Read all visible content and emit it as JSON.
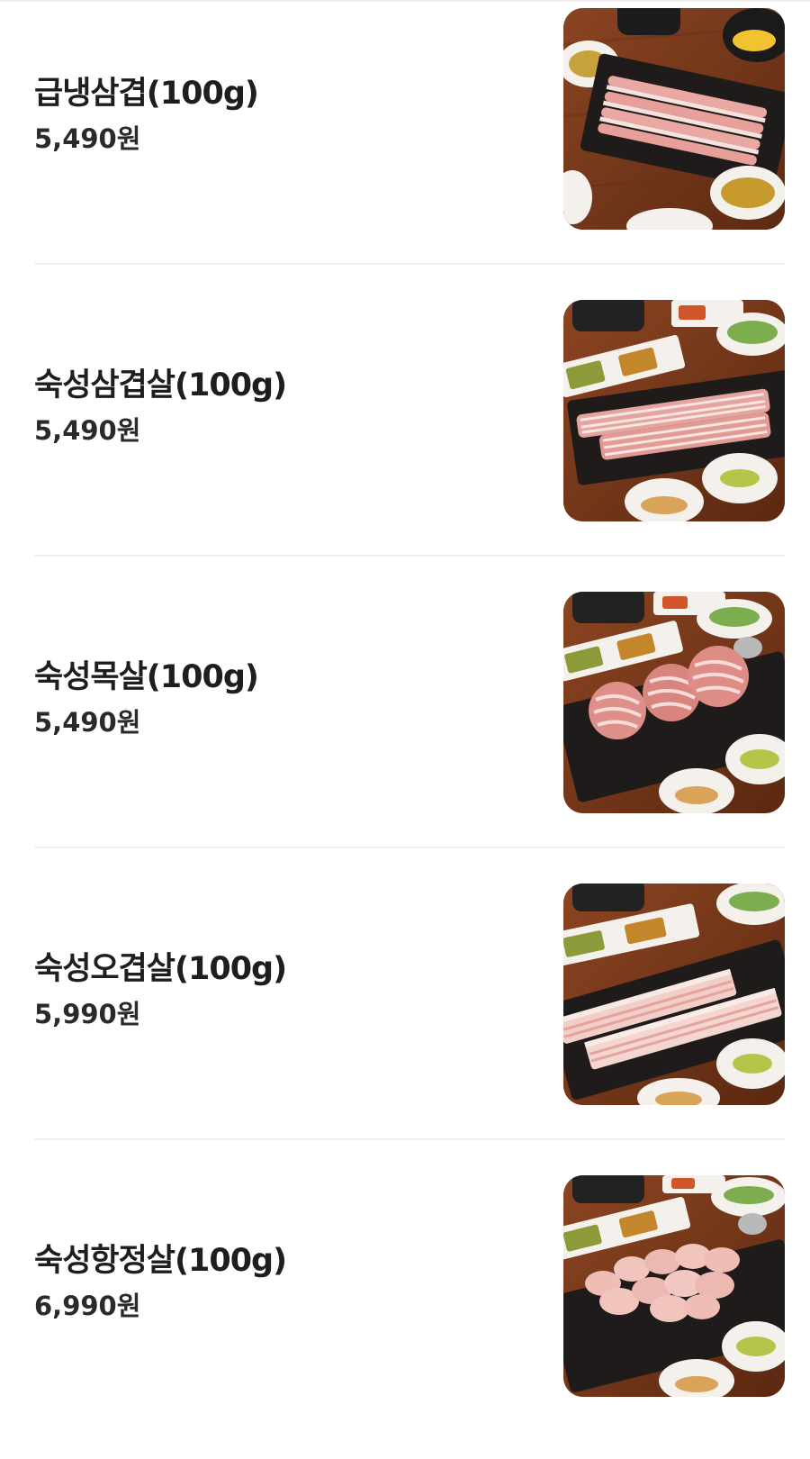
{
  "menu": {
    "items": [
      {
        "name": "급냉삼겹(100g)",
        "price": "5,490원",
        "image_icon": "frozen-pork-belly-photo"
      },
      {
        "name": "숙성삼겹살(100g)",
        "price": "5,490원",
        "image_icon": "aged-pork-belly-photo"
      },
      {
        "name": "숙성목살(100g)",
        "price": "5,490원",
        "image_icon": "aged-pork-neck-photo"
      },
      {
        "name": "숙성오겹살(100g)",
        "price": "5,990원",
        "image_icon": "aged-pork-belly-skin-photo"
      },
      {
        "name": "숙성항정살(100g)",
        "price": "6,990원",
        "image_icon": "aged-pork-jowl-photo"
      }
    ]
  },
  "colors": {
    "wood_table": "#7a3a1c",
    "slate_plate": "#1e1b1a",
    "pork_meat": "#e9a9a2",
    "pork_fat": "#f6e1dc",
    "side_dish_bowl": "#f4f1ec"
  }
}
